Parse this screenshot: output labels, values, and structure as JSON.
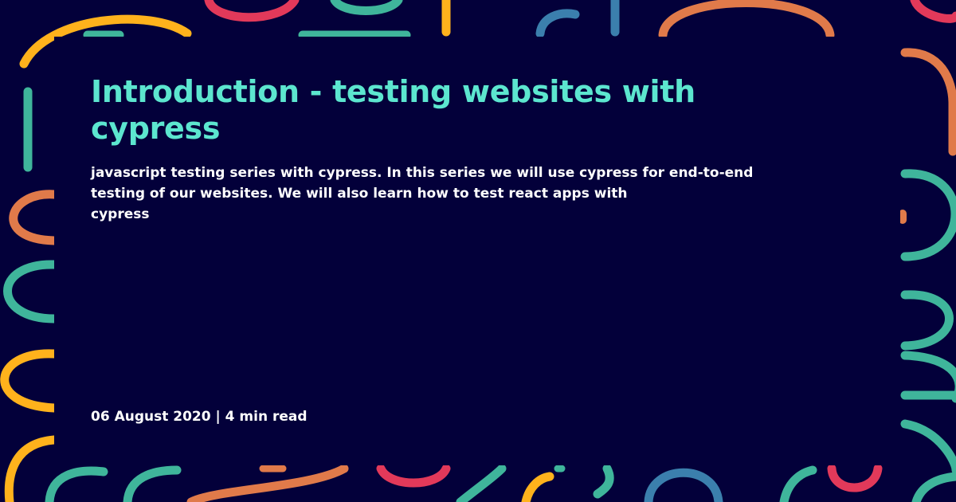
{
  "post": {
    "title": "Introduction - testing websites with cypress",
    "description_lines": [
      "javascript testing series with cypress. In this series we will use cypress for end-to-end",
      "testing of our websites. We will also learn how to test react apps with",
      "cypress"
    ],
    "date": "06 August 2020",
    "separator": "|",
    "read_time": "4 min read"
  },
  "colors": {
    "background": "#03003a",
    "title": "#5ce6cf",
    "text": "#ffffff",
    "decor": [
      "#3fb59b",
      "#e2395a",
      "#ffb21c",
      "#e07a4a",
      "#3b7fad"
    ]
  }
}
